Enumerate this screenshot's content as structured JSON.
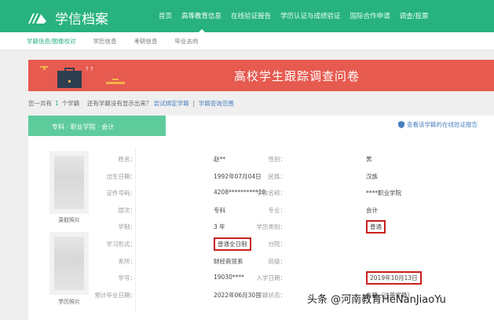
{
  "header": {
    "logo": "学信档案",
    "menu": [
      "首页",
      "高等教育信息",
      "在线验证报告",
      "学历认证与成绩验证",
      "国际合作申请",
      "调查/投票"
    ],
    "active": 1
  },
  "subnav": [
    "学籍信息/图像校对",
    "学历信息",
    "考研信息",
    "毕业去向"
  ],
  "banner": {
    "title": "高校学生跟踪调查问卷"
  },
  "info": {
    "prefix": "您一共有",
    "count": "1",
    "suffix": "个学籍",
    "question": "还有学籍没有显示出来？",
    "link1": "尝试绑定学籍",
    "sep": "|",
    "link2": "学籍查询范围"
  },
  "card": {
    "tab": "专科 · 职业学院 · 会计",
    "verify_link": "查看该学籍的在线验证报告",
    "photos": [
      "录取照片",
      "学历照片"
    ],
    "left": [
      {
        "label": "姓名：",
        "value": "赵**"
      },
      {
        "label": "出生日期：",
        "value": "1992年07月04日"
      },
      {
        "label": "证件号码：",
        "value": "4208**********10"
      },
      {
        "label": "层次：",
        "value": "专科"
      },
      {
        "label": "学制：",
        "value": "3 年"
      },
      {
        "label": "学习形式：",
        "value": "普通全日制"
      },
      {
        "label": "系所：",
        "value": "财经商贸系"
      },
      {
        "label": "学号：",
        "value": "19030****"
      },
      {
        "label": "预计毕业日期：",
        "value": "2022年06月30日"
      }
    ],
    "right": [
      {
        "label": "性别：",
        "value": "男"
      },
      {
        "label": "民族：",
        "value": "汉族"
      },
      {
        "label": "学校名称：",
        "value": "****职业学院"
      },
      {
        "label": "专业：",
        "value": "会计"
      },
      {
        "label": "学历类别：",
        "value": "普通"
      },
      {
        "label": "分院：",
        "value": ""
      },
      {
        "label": "班级：",
        "value": ""
      },
      {
        "label": "入学日期：",
        "value": "2019年10月13日"
      },
      {
        "label": "学籍状态：",
        "value": "在籍（注册学籍）"
      }
    ]
  },
  "watermark": "头条 @河南教育HeNanJiaoYu",
  "colors": {
    "green": "#27b27f",
    "red": "#e65a4f",
    "highlight": "#c9201d"
  }
}
